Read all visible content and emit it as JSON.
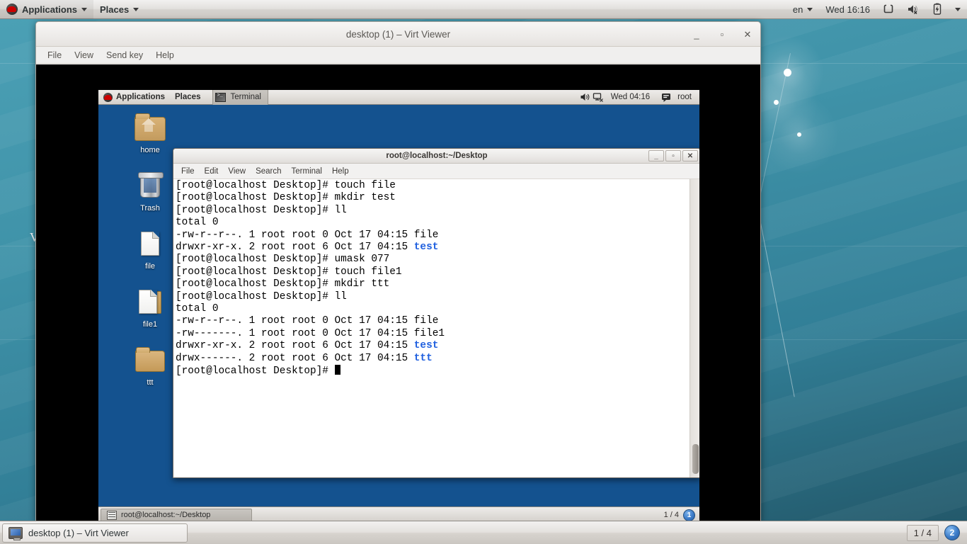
{
  "host": {
    "top_panel": {
      "applications_label": "Applications",
      "places_label": "Places",
      "keyboard_layout": "en",
      "clock": "Wed 16:16",
      "icons": [
        "redhat-logo",
        "chevron-down-icon",
        "chevron-down-icon",
        "display-icon",
        "volume-muted-icon",
        "battery-charging-icon",
        "chevron-down-icon"
      ]
    },
    "taskbar": {
      "task_label": "desktop (1) – Virt Viewer",
      "workspace_indicator": "1 / 4",
      "workspace_badge": "2"
    }
  },
  "virt_viewer": {
    "title": "desktop (1) – Virt Viewer",
    "window_buttons": {
      "minimize": "_",
      "maximize": "▫",
      "close": "✕"
    },
    "menu": [
      "File",
      "View",
      "Send key",
      "Help"
    ]
  },
  "guest": {
    "top_panel": {
      "applications_label": "Applications",
      "places_label": "Places",
      "active_task": "Terminal",
      "clock": "Wed 04:16",
      "user": "root"
    },
    "desktop_icons": [
      {
        "name": "home",
        "label": "home",
        "type": "home-folder"
      },
      {
        "name": "trash",
        "label": "Trash",
        "type": "trash"
      },
      {
        "name": "file",
        "label": "file",
        "type": "document"
      },
      {
        "name": "file1",
        "label": "file1",
        "type": "document"
      },
      {
        "name": "ttt",
        "label": "ttt",
        "type": "folder"
      }
    ],
    "bottom_panel": {
      "task_label": "root@localhost:~/Desktop",
      "workspace_indicator": "1 / 4",
      "workspace_badge": "1"
    }
  },
  "terminal": {
    "title": "root@localhost:~/Desktop",
    "menu": [
      "File",
      "Edit",
      "View",
      "Search",
      "Terminal",
      "Help"
    ],
    "window_buttons": {
      "minimize": "_",
      "maximize": "▫",
      "close": "✕"
    },
    "prompt": "[root@localhost Desktop]# ",
    "dir_color": "#2060df",
    "lines": [
      {
        "type": "prompt",
        "command": "touch file"
      },
      {
        "type": "prompt",
        "command": "mkdir test"
      },
      {
        "type": "prompt",
        "command": "ll"
      },
      {
        "type": "out",
        "text": "total 0"
      },
      {
        "type": "out",
        "text": "-rw-r--r--. 1 root root 0 Oct 17 04:15 file"
      },
      {
        "type": "out",
        "text": "drwxr-xr-x. 2 root root 6 Oct 17 04:15 ",
        "dir": "test"
      },
      {
        "type": "prompt",
        "command": "umask 077"
      },
      {
        "type": "prompt",
        "command": "touch file1"
      },
      {
        "type": "prompt",
        "command": "mkdir ttt"
      },
      {
        "type": "prompt",
        "command": "ll"
      },
      {
        "type": "out",
        "text": "total 0"
      },
      {
        "type": "out",
        "text": "-rw-r--r--. 1 root root 0 Oct 17 04:15 file"
      },
      {
        "type": "out",
        "text": "-rw-------. 1 root root 0 Oct 17 04:15 file1"
      },
      {
        "type": "out",
        "text": "drwxr-xr-x. 2 root root 6 Oct 17 04:15 ",
        "dir": "test"
      },
      {
        "type": "out",
        "text": "drwx------. 2 root root 6 Oct 17 04:15 ",
        "dir": "ttt"
      },
      {
        "type": "prompt",
        "command": "",
        "cursor": true
      }
    ]
  },
  "wallpaper": {
    "stray_text": "V"
  }
}
